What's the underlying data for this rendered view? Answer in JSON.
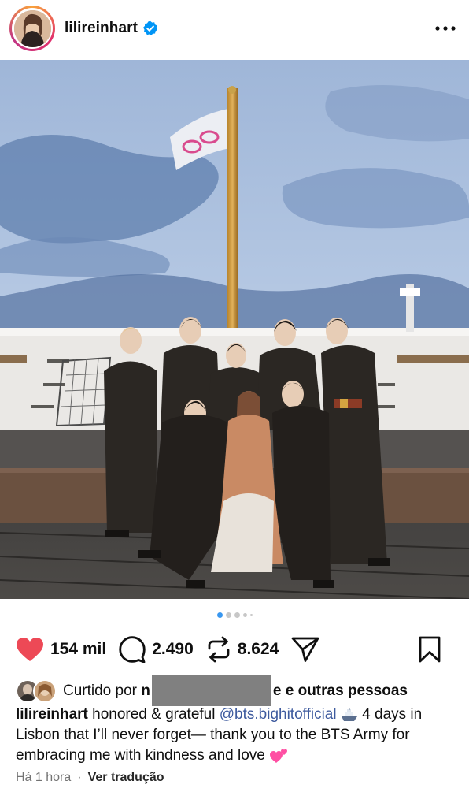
{
  "post": {
    "username": "lilireinhart",
    "verified": true,
    "icons": {
      "verified": "verified-badge-icon",
      "more": "more-options-icon"
    }
  },
  "carousel": {
    "count": 5,
    "active_index": 0
  },
  "actions": {
    "likes_count": "154 mil",
    "comments_count": "2.490",
    "reposts_count": "8.624",
    "icons": [
      "heart-filled-icon",
      "comment-icon",
      "repost-icon",
      "share-icon",
      "bookmark-icon"
    ],
    "like_color": "#ed4956"
  },
  "liked_by": {
    "prefix": "Curtido por",
    "name_visible": "n",
    "name_tail": "e",
    "suffix": "e outras pessoas"
  },
  "caption": {
    "username": "lilireinhart",
    "text_1": " honored & grateful ",
    "mention": "@bts.bighitofficial",
    "text_2": " 4 days in Lisbon that I’ll never forget—  thank you to the BTS Army for embracing me with kindness and love ",
    "mention_color": "#3d5a9e"
  },
  "footer": {
    "time": "Há 1 hora",
    "separator": "·",
    "translate": "Ver tradução"
  }
}
